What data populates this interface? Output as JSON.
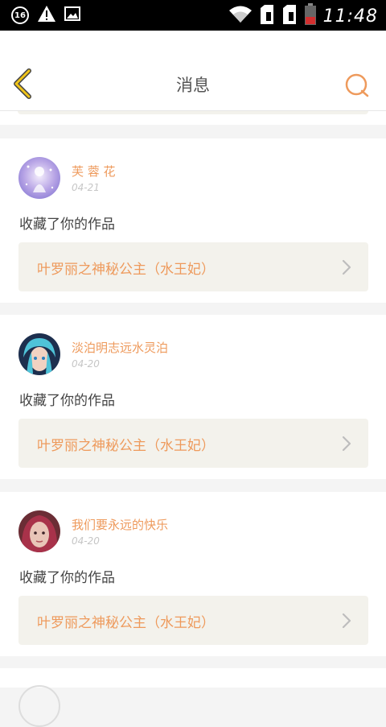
{
  "status_bar": {
    "badge": "16",
    "time": "11:48",
    "icons": [
      "notification-count-icon",
      "warning-icon",
      "image-icon",
      "wifi-icon",
      "sim1-icon",
      "sim2-icon",
      "battery-icon"
    ]
  },
  "header": {
    "title": "消息",
    "back_icon": "chevron-left-icon",
    "search_icon": "search-icon"
  },
  "colors": {
    "accent": "#ee9a5c",
    "back_arrow": "#f0c419",
    "box_bg": "#f3f2ec"
  },
  "messages": [
    {
      "username": "芙 蓉 花",
      "date": "04-21",
      "action": "收藏了你的作品",
      "work_title": "叶罗丽之神秘公主（水王妃）"
    },
    {
      "username": "淡泊明志远水灵泊",
      "date": "04-20",
      "action": "收藏了你的作品",
      "work_title": "叶罗丽之神秘公主（水王妃）"
    },
    {
      "username": "我们要永远的快乐",
      "date": "04-20",
      "action": "收藏了你的作品",
      "work_title": "叶罗丽之神秘公主（水王妃）"
    }
  ]
}
